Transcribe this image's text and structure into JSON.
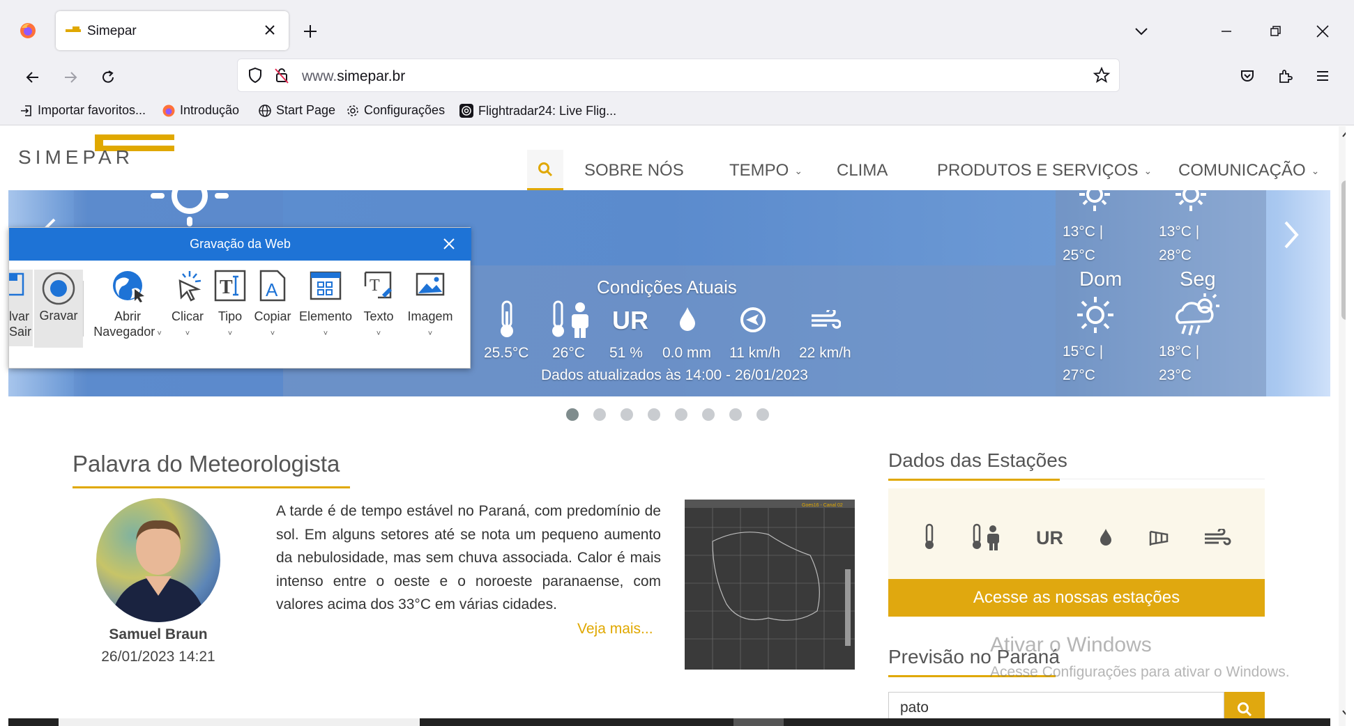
{
  "browser": {
    "tab_title": "Simepar",
    "url_domain": "simepar.br",
    "url_prefix": "www.",
    "bookmarks": [
      "Importar favoritos...",
      "Introdução",
      "Start Page",
      "Configurações",
      "Flightradar24: Live Flig..."
    ]
  },
  "site": {
    "logo_text": "SIMEPAR",
    "nav": {
      "sobre": "SOBRE NÓS",
      "tempo": "TEMPO",
      "clima": "CLIMA",
      "produtos": "PRODUTOS E SERVIÇOS",
      "comunicacao": "COMUNICAÇÃO"
    }
  },
  "banner": {
    "conditions_title": "Condições Atuais",
    "ur_label": "UR",
    "values": {
      "temp": "25.5°C",
      "feels": "26°C",
      "humidity": "51 %",
      "rain": "0.0 mm",
      "wind": "11 km/h",
      "gust": "22 km/h"
    },
    "updated": "Dados atualizados às 14:00 - 26/01/2023",
    "forecast": {
      "top_left_min": "13°C |",
      "top_left_max": "25°C",
      "top_right_min": "13°C |",
      "top_right_max": "28°C",
      "day1": "Dom",
      "day1_min": "15°C |",
      "day1_max": "27°C",
      "day2": "Seg",
      "day2_min": "18°C |",
      "day2_max": "23°C"
    }
  },
  "recorder": {
    "title": "Gravação da Web",
    "partial_label_1": "lvar",
    "partial_label_2": "Sair",
    "tools": {
      "gravar": "Gravar",
      "abrir_1": "Abrir",
      "abrir_2": "Navegador",
      "clicar": "Clicar",
      "tipo": "Tipo",
      "copiar": "Copiar",
      "elemento": "Elemento",
      "texto": "Texto",
      "imagem": "Imagem"
    }
  },
  "meteorologist": {
    "section_title": "Palavra do Meteorologista",
    "name": "Samuel Braun",
    "datetime": "26/01/2023 14:21",
    "text": "A tarde é de tempo estável no Paraná, com predomínio de sol. Em alguns setores até se nota um pequeno aumento da nebulosidade, mas sem chuva associada. Calor é mais intenso entre o oeste e o noroeste paranaense, com valores acima dos 33°C em várias cidades.",
    "more": "Veja mais...",
    "satellite_label": "Goes16 - Canal 02"
  },
  "stations": {
    "section_title": "Dados das Estações",
    "ur_label": "UR",
    "button": "Acesse as nossas estações"
  },
  "forecast_pr": {
    "section_title": "Previsão no Paraná",
    "search_value": "pato"
  },
  "watermark": {
    "line1": "Ativar o Windows",
    "line2": "Acesse Configurações para ativar o Windows."
  },
  "colors": {
    "accent": "#e0a800",
    "recorder_blue": "#1e73d6",
    "banner_blue": "#5b8bcd"
  }
}
